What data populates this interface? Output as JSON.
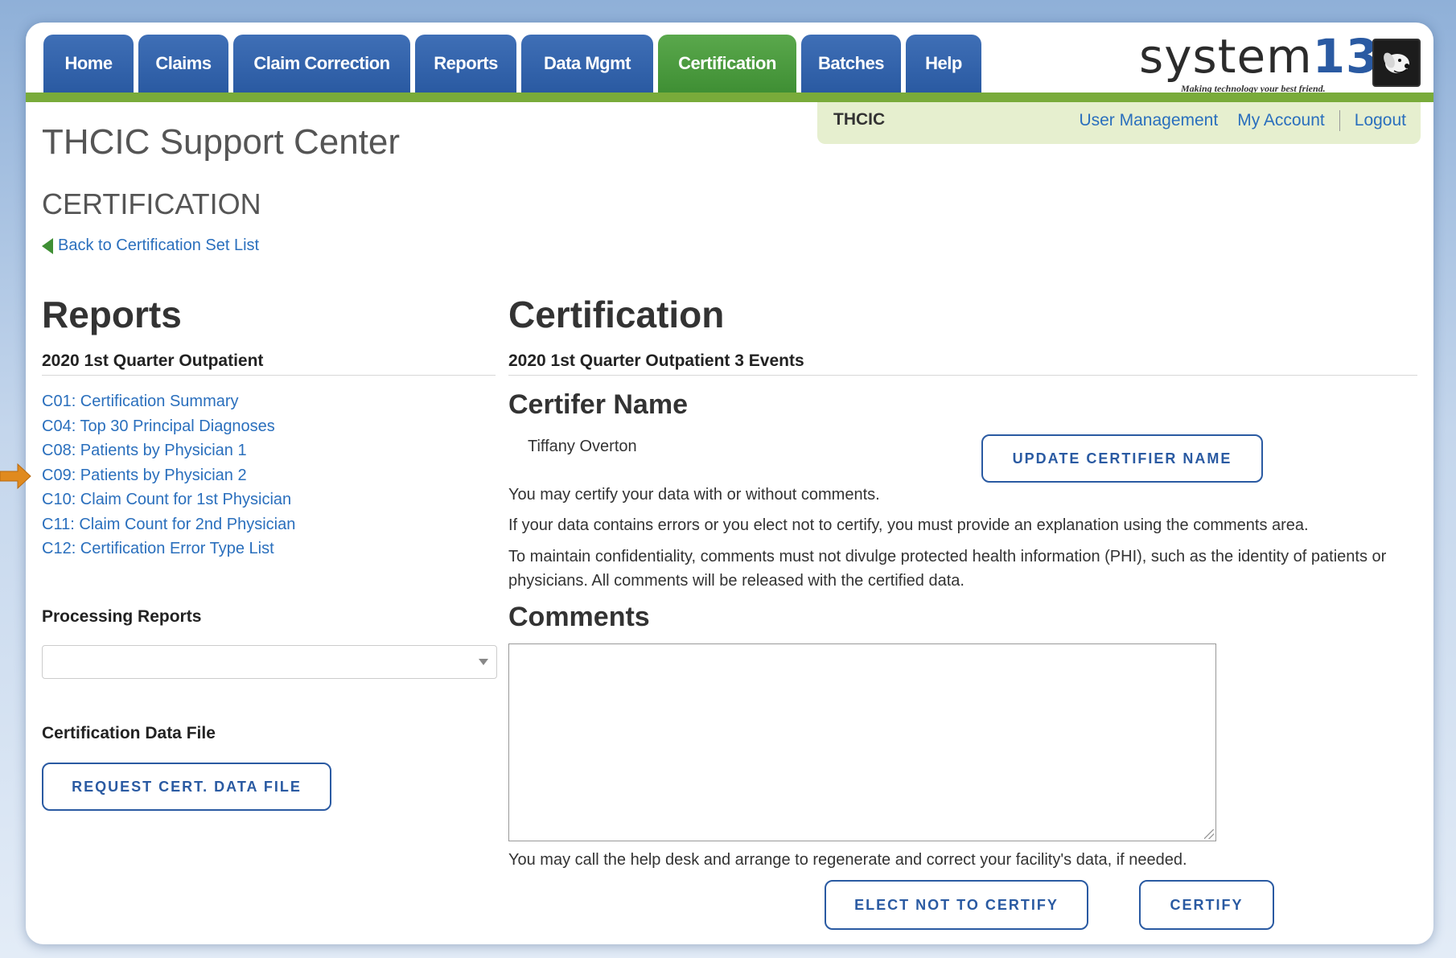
{
  "nav": {
    "tabs": [
      {
        "label": "Home"
      },
      {
        "label": "Claims"
      },
      {
        "label": "Claim Correction"
      },
      {
        "label": "Reports"
      },
      {
        "label": "Data Mgmt"
      },
      {
        "label": "Certification"
      },
      {
        "label": "Batches"
      },
      {
        "label": "Help"
      }
    ],
    "active_tab": "Certification"
  },
  "logo": {
    "brand": "system",
    "brand_num": "13",
    "tagline": "Making technology your best friend."
  },
  "user_panel": {
    "org": "THCIC",
    "links": {
      "user_management": "User Management",
      "my_account": "My Account",
      "logout": "Logout"
    }
  },
  "page": {
    "site_title": "THCIC Support Center",
    "section_title": "CERTIFICATION",
    "back_link": "Back to Certification Set List"
  },
  "reports": {
    "heading": "Reports",
    "subheading": "2020 1st Quarter Outpatient",
    "items": [
      "C01: Certification Summary",
      "C04: Top 30 Principal Diagnoses",
      "C08: Patients by Physician 1",
      "C09: Patients by Physician 2",
      "C10: Claim Count for 1st Physician",
      "C11: Claim Count for 2nd Physician",
      "C12: Certification Error Type List"
    ],
    "processing_heading": "Processing Reports",
    "processing_selected": "",
    "data_file_heading": "Certification Data File",
    "request_button": "REQUEST CERT. DATA FILE"
  },
  "certification": {
    "heading": "Certification",
    "subheading": "2020 1st Quarter Outpatient 3 Events",
    "certifier_heading": "Certifer Name",
    "certifier_name": "Tiffany Overton",
    "update_button": "UPDATE CERTIFIER NAME",
    "para1": "You may certify your data with or without comments.",
    "para2": "If your data contains errors or you elect not to certify, you must provide an explanation using the comments area.",
    "para3": "To maintain confidentiality, comments must not divulge protected health information (PHI), such as the identity of patients or physicians. All comments will be released with the certified data.",
    "comments_heading": "Comments",
    "comments_value": "",
    "help_text": "You may call the help desk and arrange to regenerate and correct your facility's data, if needed.",
    "elect_button": "ELECT NOT TO CERTIFY",
    "certify_button": "CERTIFY"
  },
  "colors": {
    "tab_blue": "#2a5aa2",
    "tab_active_green": "#3f8f34",
    "link_blue": "#2a6fbd",
    "annotation_arrow": "#e08a1e"
  }
}
